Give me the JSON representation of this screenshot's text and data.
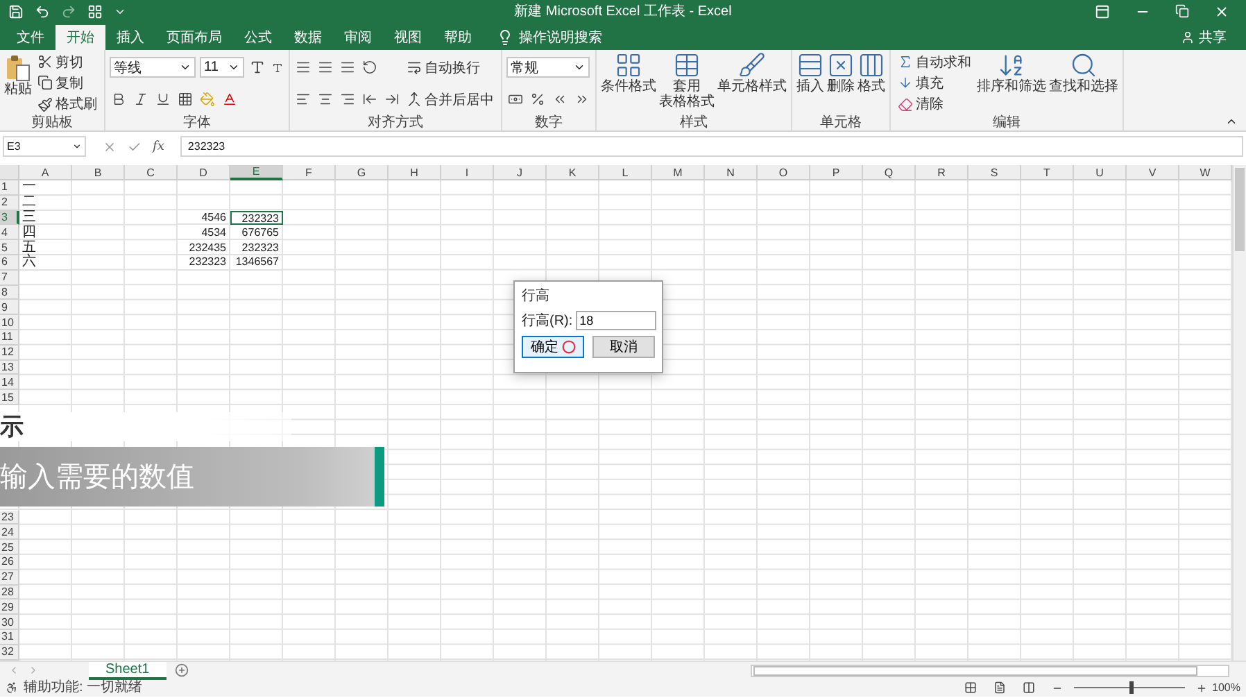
{
  "window": {
    "title": "新建 Microsoft Excel 工作表 - Excel"
  },
  "ribbon_tabs": [
    {
      "label": "文件",
      "selected": false
    },
    {
      "label": "开始",
      "selected": true
    },
    {
      "label": "插入",
      "selected": false
    },
    {
      "label": "页面布局",
      "selected": false
    },
    {
      "label": "公式",
      "selected": false
    },
    {
      "label": "数据",
      "selected": false
    },
    {
      "label": "审阅",
      "selected": false
    },
    {
      "label": "视图",
      "selected": false
    },
    {
      "label": "帮助",
      "selected": false
    }
  ],
  "tell_me": {
    "label": "操作说明搜索"
  },
  "share": {
    "label": "共享"
  },
  "ribbon_groups": [
    {
      "kind": "clipboard",
      "label": "剪贴板",
      "paste": "粘贴",
      "items": [
        "剪切",
        "复制",
        "格式刷"
      ]
    },
    {
      "kind": "font",
      "label": "字体",
      "font_name": "等线",
      "font_size": "11"
    },
    {
      "kind": "alignment",
      "label": "对齐方式",
      "wrap": "自动换行",
      "merge": "合并后居中"
    },
    {
      "kind": "number",
      "label": "数字",
      "format": "常规"
    },
    {
      "kind": "styles",
      "label": "样式",
      "buttons": [
        {
          "lines": [
            "条件格式"
          ]
        },
        {
          "lines": [
            "套用",
            "表格格式"
          ]
        },
        {
          "lines": [
            "单元格样式"
          ]
        }
      ]
    },
    {
      "kind": "cells",
      "label": "单元格",
      "buttons": [
        {
          "lines": [
            "插入"
          ]
        },
        {
          "lines": [
            "删除"
          ]
        },
        {
          "lines": [
            "格式"
          ]
        }
      ]
    },
    {
      "kind": "editing",
      "label": "编辑",
      "items": [
        "自动求和",
        "填充",
        "清除"
      ],
      "buttons": [
        {
          "lines": [
            "排序和筛选"
          ]
        },
        {
          "lines": [
            "查找和选择"
          ]
        }
      ]
    }
  ],
  "formula_bar": {
    "name_box": "E3",
    "function_label": "fx",
    "value": "232323"
  },
  "columns": [
    "A",
    "B",
    "C",
    "D",
    "E",
    "F",
    "G",
    "H",
    "I",
    "J",
    "K",
    "L",
    "M",
    "N",
    "O",
    "P",
    "Q",
    "R",
    "S",
    "T",
    "U",
    "V",
    "W"
  ],
  "rows": [
    {
      "number": "1",
      "cells": {
        "A": {
          "value": "一",
          "kind": "text",
          "selected": false
        }
      }
    },
    {
      "number": "2",
      "cells": {
        "A": {
          "value": "二",
          "kind": "text",
          "selected": false
        }
      }
    },
    {
      "number": "3",
      "cells": {
        "A": {
          "value": "三",
          "kind": "text",
          "selected": false
        },
        "D": {
          "value": "4546",
          "kind": "number",
          "selected": false
        },
        "E": {
          "value": "232323",
          "kind": "number",
          "selected": true
        }
      }
    },
    {
      "number": "4",
      "cells": {
        "A": {
          "value": "四",
          "kind": "text",
          "selected": false
        },
        "D": {
          "value": "4534",
          "kind": "number",
          "selected": false
        },
        "E": {
          "value": "676765",
          "kind": "number",
          "selected": false
        }
      }
    },
    {
      "number": "5",
      "cells": {
        "A": {
          "value": "五",
          "kind": "text",
          "selected": false
        },
        "D": {
          "value": "232435",
          "kind": "number",
          "selected": false
        },
        "E": {
          "value": "232323",
          "kind": "number",
          "selected": false
        }
      }
    },
    {
      "number": "6",
      "cells": {
        "A": {
          "value": "六",
          "kind": "text",
          "selected": false
        },
        "D": {
          "value": "232323",
          "kind": "number",
          "selected": false
        },
        "E": {
          "value": "1346567",
          "kind": "number",
          "selected": false
        }
      }
    },
    {
      "number": "7"
    },
    {
      "number": "8"
    },
    {
      "number": "9"
    },
    {
      "number": "10"
    },
    {
      "number": "11"
    },
    {
      "number": "12"
    },
    {
      "number": "13"
    },
    {
      "number": "14"
    },
    {
      "number": "15"
    },
    {},
    {},
    {},
    {},
    {},
    {},
    {},
    {
      "number": "23"
    },
    {
      "number": "24"
    },
    {
      "number": "25"
    },
    {
      "number": "26"
    },
    {
      "number": "27"
    },
    {
      "number": "28"
    },
    {
      "number": "29"
    },
    {
      "number": "30"
    },
    {
      "number": "31"
    },
    {
      "number": "32"
    }
  ],
  "dialog": {
    "title": "行高",
    "label": "行高(R):",
    "value": "18",
    "buttons": [
      {
        "label": "确定",
        "default": true
      },
      {
        "label": "取消",
        "default": false
      }
    ]
  },
  "caption": {
    "heading": "示",
    "text": "输入需要的数值"
  },
  "sheet_tabs": [
    {
      "label": "Sheet1",
      "selected": true
    }
  ],
  "status_bar": {
    "text": "辅助功能: 一切就绪",
    "zoom": "100%",
    "zoom_slider": {
      "level": 0.5
    }
  }
}
